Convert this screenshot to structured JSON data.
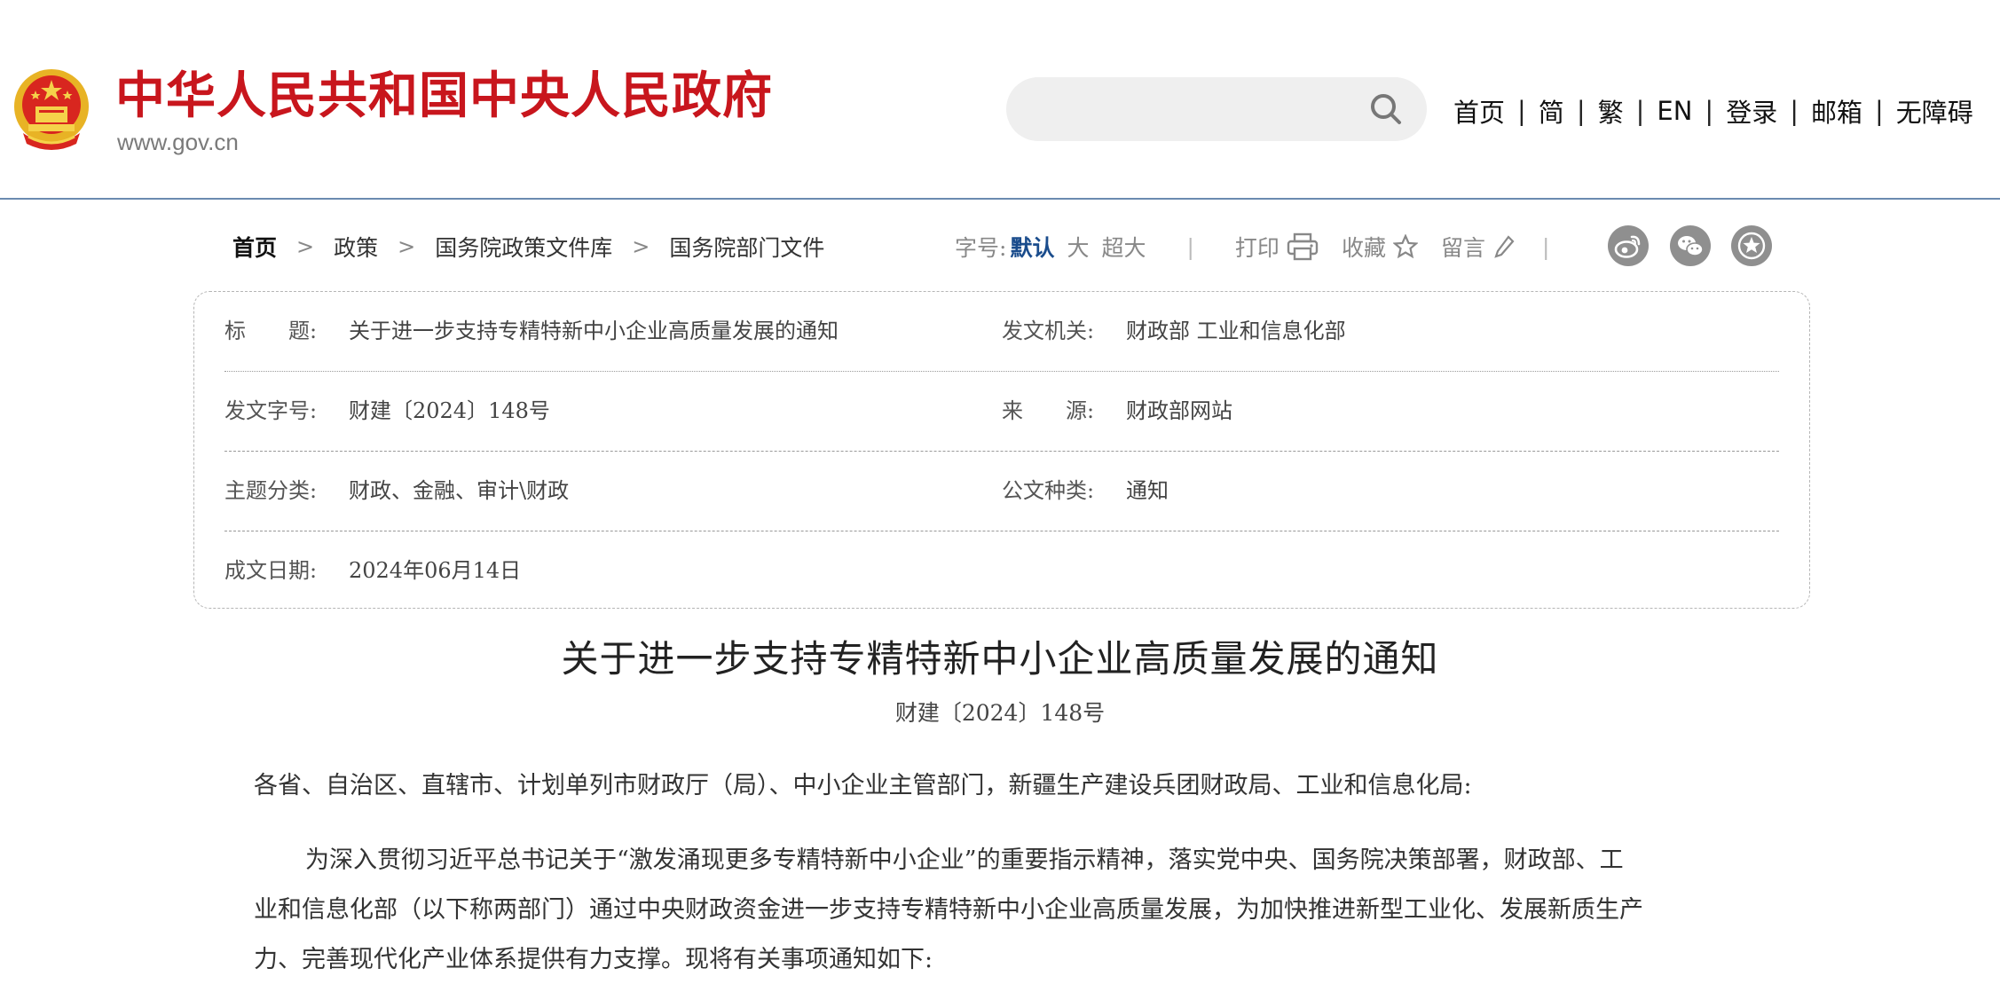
{
  "header": {
    "site_title": "中华人民共和国中央人民政府",
    "site_url": "www.gov.cn",
    "search": {
      "placeholder": "",
      "value": ""
    },
    "nav": [
      "首页",
      "简",
      "繁",
      "EN",
      "登录",
      "邮箱",
      "无障碍"
    ]
  },
  "breadcrumb": [
    "首页",
    "政策",
    "国务院政策文件库",
    "国务院部门文件"
  ],
  "tools": {
    "font_size_label": "字号:",
    "font_sizes": [
      "默认",
      "大",
      "超大"
    ],
    "print_label": "打印",
    "favorite_label": "收藏",
    "comment_label": "留言",
    "share": [
      "weibo-icon",
      "wechat-icon",
      "star-share-icon"
    ]
  },
  "info": {
    "title_label": "标　　题:",
    "title_value": "关于进一步支持专精特新中小企业高质量发展的通知",
    "issuer_label": "发文机关:",
    "issuer_value": "财政部 工业和信息化部",
    "doc_no_label": "发文字号:",
    "doc_no_value": "财建〔2024〕148号",
    "source_label": "来　　源:",
    "source_value": "财政部网站",
    "topic_label": "主题分类:",
    "topic_value": "财政、金融、审计\\财政",
    "doc_type_label": "公文种类:",
    "doc_type_value": "通知",
    "date_label": "成文日期:",
    "date_value": "2024年06月14日"
  },
  "article": {
    "title": "关于进一步支持专精特新中小企业高质量发展的通知",
    "code": "财建〔2024〕148号",
    "addressee": "各省、自治区、直辖市、计划单列市财政厅（局）、中小企业主管部门，新疆生产建设兵团财政局、工业和信息化局:",
    "paragraph_lines": [
      "为深入贯彻习近平总书记关于“激发涌现更多专精特新中小企业”的重要指示精神，落实党中央、国务院决策部署，财政部、工",
      "业和信息化部（以下称两部门）通过中央财政资金进一步支持专精特新中小企业高质量发展，为加快推进新型工业化、发展新质生产",
      "力、完善现代化产业体系提供有力支撑。现将有关事项通知如下:"
    ]
  },
  "colors": {
    "brand_red": "#c8161d",
    "header_rule": "#6b8bb0",
    "active_font_size": "#1a4c8c",
    "share_icon_bg": "#8f8f8f"
  }
}
